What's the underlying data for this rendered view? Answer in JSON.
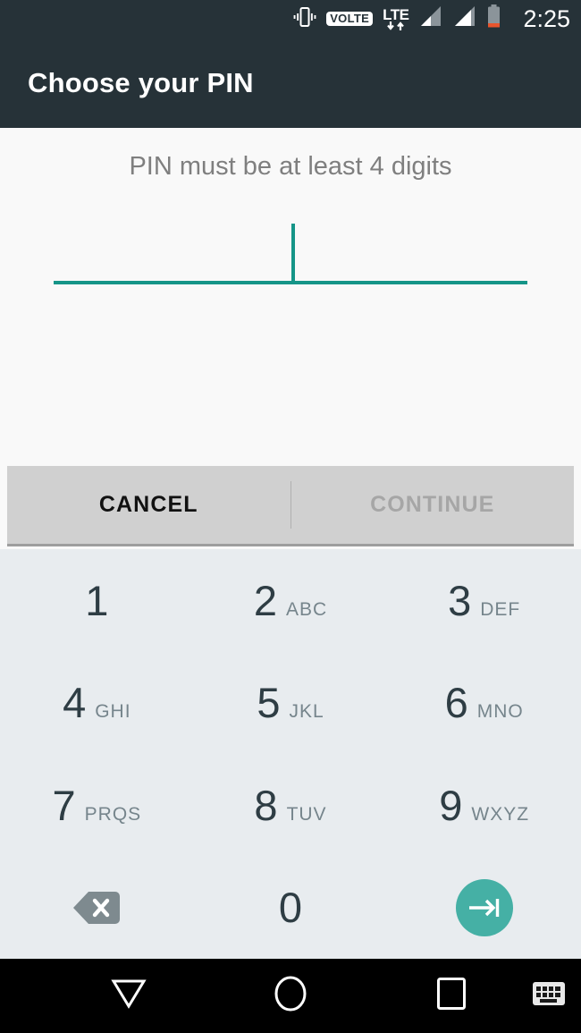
{
  "status_bar": {
    "time": "2:25",
    "icons": [
      {
        "name": "vibrate-icon",
        "label": "vibrate"
      },
      {
        "name": "volte-icon",
        "label": "VOLTE"
      },
      {
        "name": "lte-data-icon",
        "label": "LTE"
      },
      {
        "name": "signal-sim1-icon",
        "label": "signal bars sim 1"
      },
      {
        "name": "signal-sim2-icon",
        "label": "signal bars sim 2"
      },
      {
        "name": "battery-icon",
        "label": "battery low"
      }
    ],
    "background_color": "#263238"
  },
  "header": {
    "title": "Choose your PIN",
    "background_color": "#263238",
    "text_color": "#ffffff"
  },
  "main": {
    "hint": "PIN must be at least 4 digits",
    "pin_input": {
      "value": "",
      "caret_visible": true,
      "accent_color": "#159588"
    }
  },
  "action_bar": {
    "cancel_label": "CANCEL",
    "continue_label": "CONTINUE",
    "continue_enabled": false,
    "background_color": "#d0d0d0"
  },
  "keypad": {
    "background_color": "#e8ecef",
    "digit_color": "#2e3d44",
    "letters_color": "#76858c",
    "keys": [
      {
        "digit": "1",
        "letters": ""
      },
      {
        "digit": "2",
        "letters": "ABC"
      },
      {
        "digit": "3",
        "letters": "DEF"
      },
      {
        "digit": "4",
        "letters": "GHI"
      },
      {
        "digit": "5",
        "letters": "JKL"
      },
      {
        "digit": "6",
        "letters": "MNO"
      },
      {
        "digit": "7",
        "letters": "PRQS"
      },
      {
        "digit": "8",
        "letters": "TUV"
      },
      {
        "digit": "9",
        "letters": "WXYZ"
      },
      {
        "digit": "0",
        "letters": ""
      }
    ],
    "backspace": {
      "icon": "backspace-icon",
      "color": "#7e8a8f"
    },
    "enter": {
      "icon": "enter-arrow-icon",
      "color": "#45b0a5"
    }
  },
  "nav_bar": {
    "background_color": "#000000",
    "buttons": [
      {
        "name": "nav-back-button",
        "icon": "triangle-down-icon"
      },
      {
        "name": "nav-home-button",
        "icon": "circle-icon"
      },
      {
        "name": "nav-recents-button",
        "icon": "square-icon"
      },
      {
        "name": "nav-keyboard-switch-button",
        "icon": "keyboard-icon"
      }
    ]
  }
}
